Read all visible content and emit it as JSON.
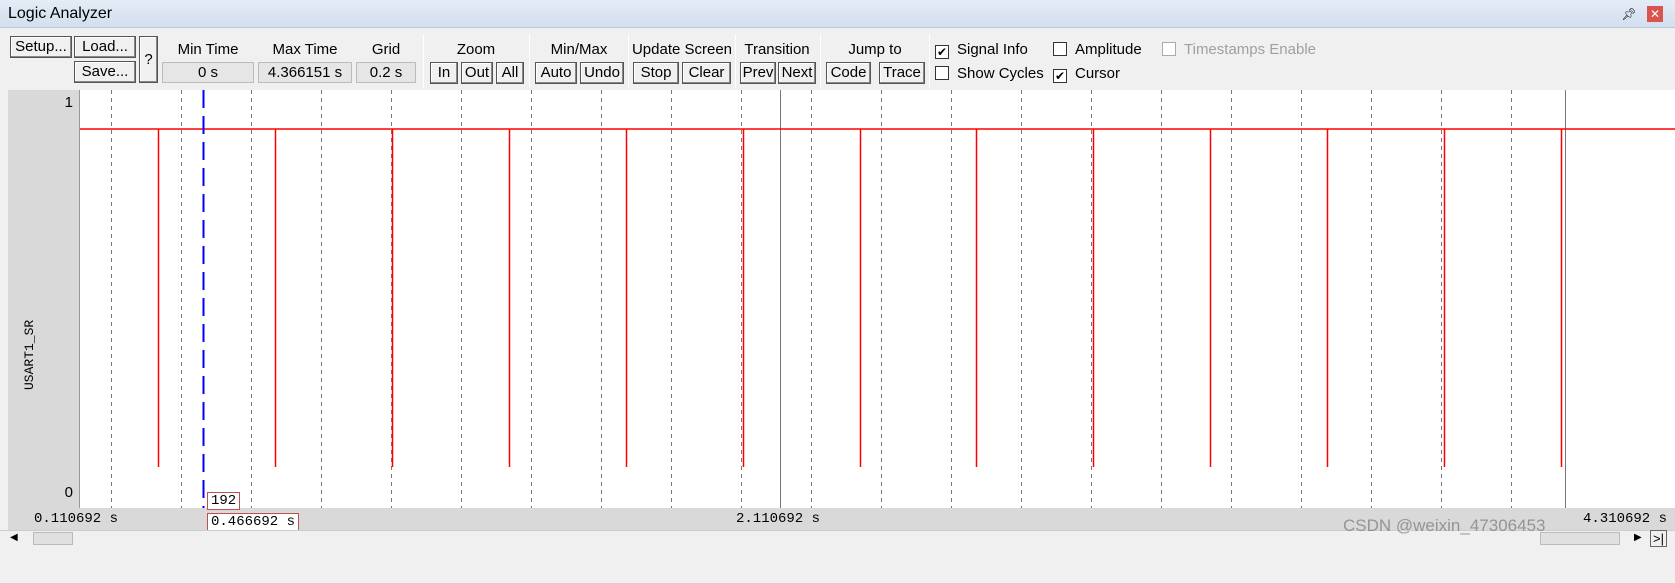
{
  "window": {
    "title": "Logic Analyzer",
    "pin_icon": "pin-icon",
    "close_icon": "close-icon"
  },
  "toolbar": {
    "setup": "Setup...",
    "load": "Load...",
    "save": "Save...",
    "help": "?",
    "min_time_label": "Min Time",
    "min_time": "0 s",
    "max_time_label": "Max Time",
    "max_time": "4.366151 s",
    "grid_label": "Grid",
    "grid": "0.2 s",
    "zoom_label": "Zoom",
    "zoom_in": "In",
    "zoom_out": "Out",
    "zoom_all": "All",
    "minmax_label": "Min/Max",
    "auto": "Auto",
    "undo": "Undo",
    "update_label": "Update Screen",
    "stop": "Stop",
    "clear": "Clear",
    "transition_label": "Transition",
    "prev": "Prev",
    "next": "Next",
    "jump_label": "Jump to",
    "code": "Code",
    "trace": "Trace",
    "signal_info": {
      "label": "Signal Info",
      "checked": true
    },
    "amplitude": {
      "label": "Amplitude",
      "checked": false
    },
    "timestamps": {
      "label": "Timestamps Enable",
      "checked": false,
      "disabled": true
    },
    "show_cycles": {
      "label": "Show Cycles",
      "checked": false
    },
    "cursor": {
      "label": "Cursor",
      "checked": true
    }
  },
  "chart_data": {
    "type": "line",
    "series": [
      {
        "name": "USART1_SR",
        "color": "#ff0000"
      }
    ],
    "signal_name": "USART1_SR",
    "y_high_label": "1",
    "y_low_label": "0",
    "view_start": 0.110692,
    "view_center": 2.110692,
    "view_end": 4.310692,
    "axis_labels": {
      "left": "0.110692 s",
      "center": "2.110692 s",
      "right": "4.310692 s"
    },
    "grid_step_s": 0.2,
    "pulse_low_times_s": [
      0.334,
      0.668,
      1.002,
      1.336,
      1.67,
      2.004,
      2.338,
      2.672,
      3.006,
      3.34,
      3.674,
      4.008,
      4.342
    ],
    "cursor": {
      "time": "0.466692 s",
      "value": 0.466692,
      "count": "192",
      "color": "#0000ff"
    }
  },
  "watermark": "CSDN @weixin_47306453"
}
